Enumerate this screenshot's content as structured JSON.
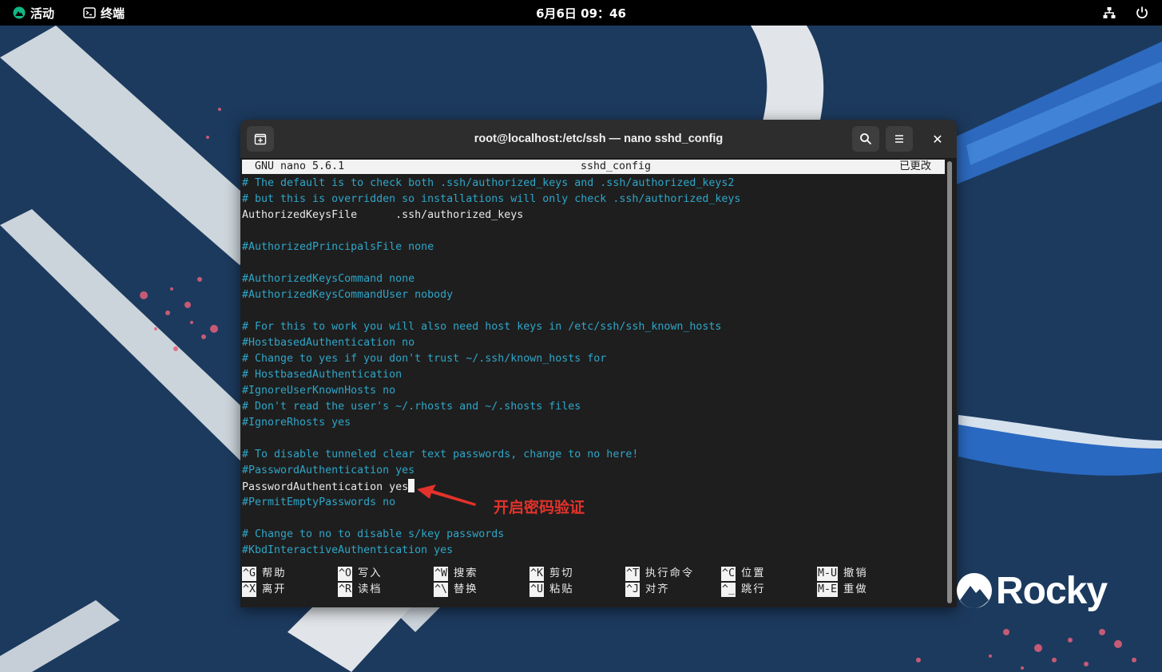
{
  "topbar": {
    "activities": "活动",
    "app_name": "终端",
    "clock": "6月6日 09：46",
    "network_icon": "network-icon",
    "power_icon": "power-icon"
  },
  "window": {
    "title": "root@localhost:/etc/ssh — nano sshd_config",
    "buttons": [
      "new-tab-icon",
      "search-icon",
      "menu-icon",
      "close-icon"
    ],
    "close_glyph": "✕"
  },
  "nano": {
    "version": "GNU nano 5.6.1",
    "filename": "sshd_config",
    "modified": "已更改",
    "lines": [
      {
        "text": "# The default is to check both .ssh/authorized_keys and .ssh/authorized_keys2",
        "kind": "comment"
      },
      {
        "text": "# but this is overridden so installations will only check .ssh/authorized_keys",
        "kind": "comment"
      },
      {
        "text": "AuthorizedKeysFile      .ssh/authorized_keys",
        "kind": "plain"
      },
      {
        "text": "",
        "kind": "plain"
      },
      {
        "text": "#AuthorizedPrincipalsFile none",
        "kind": "comment"
      },
      {
        "text": "",
        "kind": "plain"
      },
      {
        "text": "#AuthorizedKeysCommand none",
        "kind": "comment"
      },
      {
        "text": "#AuthorizedKeysCommandUser nobody",
        "kind": "comment"
      },
      {
        "text": "",
        "kind": "plain"
      },
      {
        "text": "# For this to work you will also need host keys in /etc/ssh/ssh_known_hosts",
        "kind": "comment"
      },
      {
        "text": "#HostbasedAuthentication no",
        "kind": "comment"
      },
      {
        "text": "# Change to yes if you don't trust ~/.ssh/known_hosts for",
        "kind": "comment"
      },
      {
        "text": "# HostbasedAuthentication",
        "kind": "comment"
      },
      {
        "text": "#IgnoreUserKnownHosts no",
        "kind": "comment"
      },
      {
        "text": "# Don't read the user's ~/.rhosts and ~/.shosts files",
        "kind": "comment"
      },
      {
        "text": "#IgnoreRhosts yes",
        "kind": "comment"
      },
      {
        "text": "",
        "kind": "plain"
      },
      {
        "text": "# To disable tunneled clear text passwords, change to no here!",
        "kind": "comment"
      },
      {
        "text": "#PasswordAuthentication yes",
        "kind": "comment"
      },
      {
        "text": "PasswordAuthentication yes",
        "kind": "plain",
        "cursor": true
      },
      {
        "text": "#PermitEmptyPasswords no",
        "kind": "comment"
      },
      {
        "text": "",
        "kind": "plain"
      },
      {
        "text": "# Change to no to disable s/key passwords",
        "kind": "comment"
      },
      {
        "text": "#KbdInteractiveAuthentication yes",
        "kind": "comment"
      }
    ],
    "shortcuts_row1": [
      {
        "key": "^G",
        "label": "帮助"
      },
      {
        "key": "^O",
        "label": "写入"
      },
      {
        "key": "^W",
        "label": "搜索"
      },
      {
        "key": "^K",
        "label": "剪切"
      },
      {
        "key": "^T",
        "label": "执行命令"
      },
      {
        "key": "^C",
        "label": "位置"
      },
      {
        "key": "M-U",
        "label": "撤销"
      }
    ],
    "shortcuts_row2": [
      {
        "key": "^X",
        "label": "离开"
      },
      {
        "key": "^R",
        "label": "读档"
      },
      {
        "key": "^\\",
        "label": "替换"
      },
      {
        "key": "^U",
        "label": "粘贴"
      },
      {
        "key": "^J",
        "label": "对齐"
      },
      {
        "key": "^_",
        "label": "跳行"
      },
      {
        "key": "M-E",
        "label": "重做"
      }
    ]
  },
  "annotation": {
    "text": "开启密码验证",
    "color": "#e3322b"
  },
  "logo": {
    "word": "Rocky"
  },
  "colors": {
    "wallpaper": "#1c3a5e",
    "comment": "#2ea6c8",
    "terminal_bg": "#1e1e1e"
  }
}
